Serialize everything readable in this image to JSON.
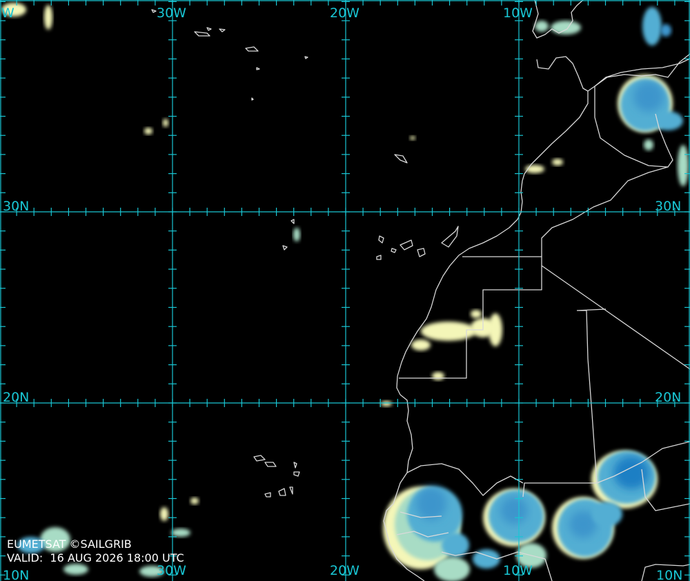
{
  "map": {
    "background_color": "#000000",
    "grid_color": "#19c6d4",
    "coast_color": "#d9d9d9",
    "cloud_colors": {
      "cold_top": "#1f7fc4",
      "mid": "#53aed3",
      "warm": "#a8dcc5",
      "low": "#f4f6b8"
    },
    "longitude_labels": [
      "30W",
      "20W",
      "10W"
    ],
    "latitude_labels": [
      "30N",
      "20N",
      "10N"
    ],
    "edge_labels": {
      "top_left": "W",
      "bottom_left": "10N",
      "bottom_right": "10N"
    }
  },
  "credit": {
    "source": "EUMETSAT ©SAILGRIB",
    "valid_label": "VALID:",
    "valid_time": "16 AUG 2026 18:00 UTC"
  }
}
